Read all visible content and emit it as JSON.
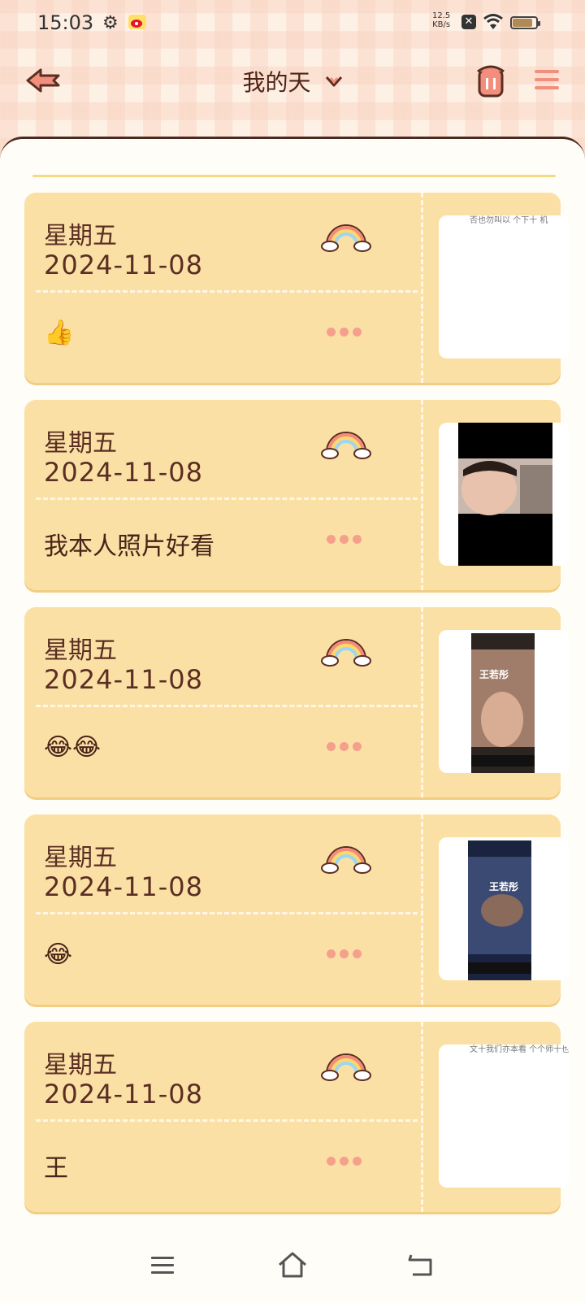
{
  "status": {
    "time": "15:03",
    "speed_value": "12.5",
    "speed_unit": "KB/s"
  },
  "header": {
    "title": "我的天"
  },
  "entries": [
    {
      "day": "星期五",
      "date": "2024-11-08",
      "content": "👍",
      "thumb": "blank",
      "thumb_text": "否也勿叫以 个下十 机"
    },
    {
      "day": "星期五",
      "date": "2024-11-08",
      "content": "我本人照片好看",
      "thumb": "selfie"
    },
    {
      "day": "星期五",
      "date": "2024-11-08",
      "content": "😂😂",
      "thumb": "video",
      "thumb_text": "王若彤"
    },
    {
      "day": "星期五",
      "date": "2024-11-08",
      "content": "😂",
      "thumb": "video2",
      "thumb_text": "王若彤"
    },
    {
      "day": "星期五",
      "date": "2024-11-08",
      "content": "王",
      "thumb": "blank",
      "thumb_text": "文十我们亦本看 个个师十也修"
    }
  ],
  "icons": {
    "back": "back-arrow-icon",
    "chevron": "chevron-down-icon",
    "trash": "trash-bin-icon",
    "menu": "hamburger-menu-icon",
    "weather": "rainbow-icon",
    "more": "more-dots-icon"
  },
  "colors": {
    "card": "#fbe0a6",
    "accent": "#f4a08c",
    "text": "#5a2e22"
  }
}
